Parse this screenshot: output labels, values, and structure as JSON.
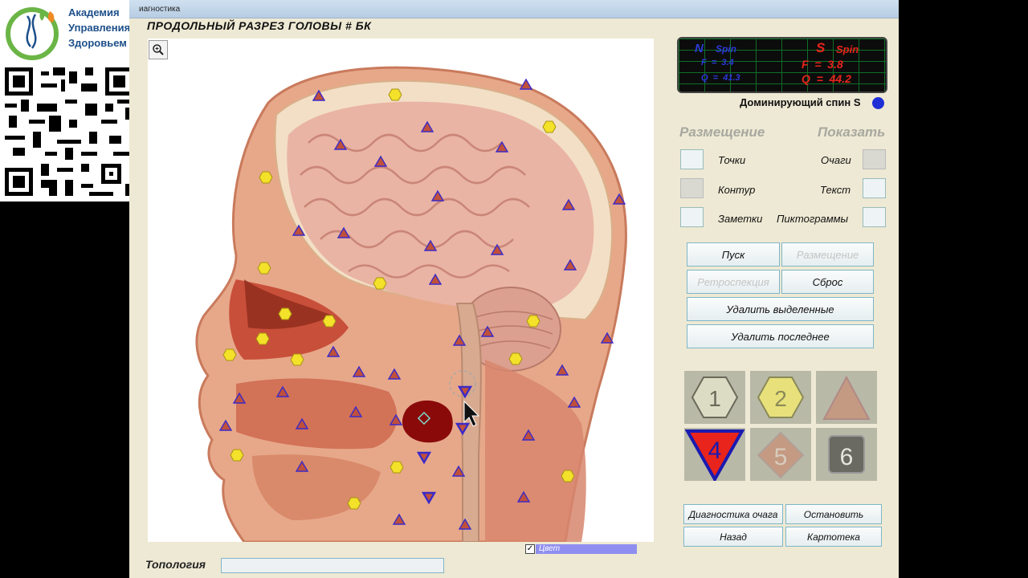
{
  "logo": {
    "line1": "Академия",
    "line2": "Управления",
    "line3": "Здоровьем"
  },
  "window": {
    "title": "иагностика"
  },
  "heading": "ПРОДОЛЬНЫЙ  РАЗРЕЗ  ГОЛОВЫ # БК",
  "spin_display": {
    "n_label": "N",
    "n_spin_label": "Spin",
    "n_f": "F  =  3.4",
    "n_q": "Q  =  41.3",
    "s_label": "S",
    "s_spin_label": "Spin",
    "s_f": "F  =  3.8",
    "s_q": "Q  =  44.2"
  },
  "dominant": {
    "label": "Доминирующий спин S",
    "color": "#1e2fd6"
  },
  "placement": {
    "title": "Размещение",
    "points": "Точки",
    "contour": "Контур",
    "notes": "Заметки"
  },
  "show": {
    "title": "Показать",
    "foci": "Очаги",
    "text": "Текст",
    "pictograms": "Пиктограммы"
  },
  "buttons": {
    "start": "Пуск",
    "placement": "Размещение",
    "retrospection": "Ретроспекция",
    "reset": "Сброс",
    "delete_selected": "Удалить выделенные",
    "delete_last": "Удалить последнее"
  },
  "markers": {
    "m1": "1",
    "m2": "2",
    "m3": "",
    "m4": "4",
    "m5": "5",
    "m6": "6"
  },
  "bottom_buttons": {
    "focus_diagnostics": "Диагностика очага",
    "stop": "Остановить",
    "back": "Назад",
    "card_index": "Картотека"
  },
  "topology": {
    "label": "Топология",
    "value": ""
  },
  "color_toggle": {
    "label": "Цвет",
    "checked": "✓"
  },
  "colors": {
    "triangle": "#c0503a",
    "hexagon": "#f3e12a",
    "inverted_triangle": "#3a2ac9",
    "focus": "#8a0a0a"
  }
}
